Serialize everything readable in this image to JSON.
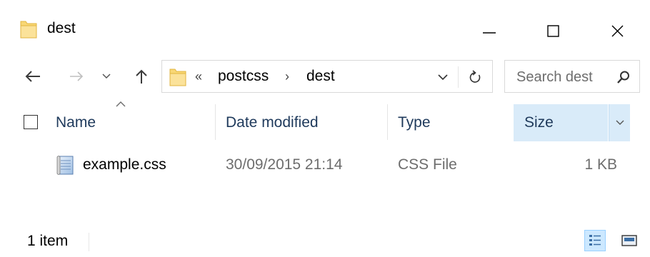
{
  "window": {
    "title": "dest",
    "folder_color": "#f8d775",
    "accent_selected": "#d9ebf9"
  },
  "address": {
    "overflow": "«",
    "crumbs": [
      "postcss",
      "dest"
    ],
    "separator": "›"
  },
  "search": {
    "placeholder": "Search dest"
  },
  "columns": {
    "name": "Name",
    "date": "Date modified",
    "type": "Type",
    "size": "Size"
  },
  "files": [
    {
      "name": "example.css",
      "date": "30/09/2015 21:14",
      "type": "CSS File",
      "size": "1 KB",
      "icon": "css-file-icon"
    }
  ],
  "status": {
    "count": "1 item"
  },
  "icons": {
    "back": "arrow-left-icon",
    "forward": "arrow-right-icon",
    "recent": "chevron-down-icon",
    "up": "arrow-up-icon",
    "refresh": "refresh-icon",
    "search": "search-icon",
    "minimize": "minimize-icon",
    "maximize": "maximize-icon",
    "close": "close-icon",
    "details_view": "details-view-icon",
    "tiles_view": "large-icons-view-icon"
  }
}
